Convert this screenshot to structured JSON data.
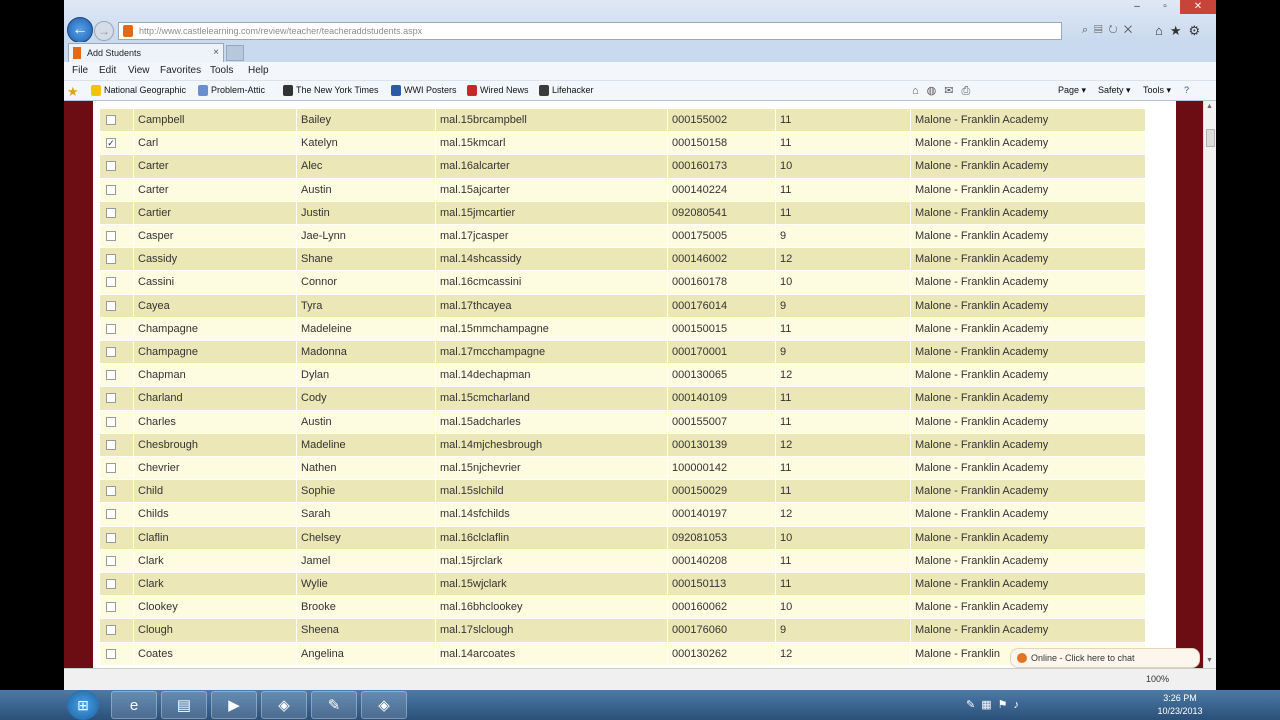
{
  "browser": {
    "url": "http://www.castlelearning.com/review/teacher/teacheraddstudents.aspx",
    "tab_title": "Add Students",
    "tab_close": "×",
    "window_controls": [
      "–",
      "▫",
      "✕"
    ],
    "menu": [
      "File",
      "Edit",
      "View",
      "Favorites",
      "Tools",
      "Help"
    ],
    "favorites": [
      {
        "label": "National Geographic",
        "color": "#f2c400"
      },
      {
        "label": "Problem-Attic",
        "color": "#6a8fd1"
      },
      {
        "label": "The New York Times",
        "color": "#333333"
      },
      {
        "label": "WWI Posters",
        "color": "#2a5aa8"
      },
      {
        "label": "Wired News",
        "color": "#c62828"
      },
      {
        "label": "Lifehacker",
        "color": "#3b3b3b"
      }
    ],
    "commands": [
      "Page ▾",
      "Safety ▾",
      "Tools ▾"
    ],
    "zoom": "100%",
    "chat": "Online - Click here to chat"
  },
  "colors": {
    "frame": "#6b0d12",
    "row_a": "#fdfbe0",
    "row_b": "#ece7b6"
  },
  "rows": [
    {
      "checked": false,
      "last": "Campbell",
      "first": "Bailey",
      "user": "mal.15brcampbell",
      "id": "000155002",
      "grade": "11",
      "school": "Malone - Franklin Academy"
    },
    {
      "checked": true,
      "last": "Carl",
      "first": "Katelyn",
      "user": "mal.15kmcarl",
      "id": "000150158",
      "grade": "11",
      "school": "Malone - Franklin Academy"
    },
    {
      "checked": false,
      "last": "Carter",
      "first": "Alec",
      "user": "mal.16alcarter",
      "id": "000160173",
      "grade": "10",
      "school": "Malone - Franklin Academy"
    },
    {
      "checked": false,
      "last": "Carter",
      "first": "Austin",
      "user": "mal.15ajcarter",
      "id": "000140224",
      "grade": "11",
      "school": "Malone - Franklin Academy"
    },
    {
      "checked": false,
      "last": "Cartier",
      "first": "Justin",
      "user": "mal.15jmcartier",
      "id": "092080541",
      "grade": "11",
      "school": "Malone - Franklin Academy"
    },
    {
      "checked": false,
      "last": "Casper",
      "first": "Jae-Lynn",
      "user": "mal.17jcasper",
      "id": "000175005",
      "grade": "9",
      "school": "Malone - Franklin Academy"
    },
    {
      "checked": false,
      "last": "Cassidy",
      "first": "Shane",
      "user": "mal.14shcassidy",
      "id": "000146002",
      "grade": "12",
      "school": "Malone - Franklin Academy"
    },
    {
      "checked": false,
      "last": "Cassini",
      "first": "Connor",
      "user": "mal.16cmcassini",
      "id": "000160178",
      "grade": "10",
      "school": "Malone - Franklin Academy"
    },
    {
      "checked": false,
      "last": "Cayea",
      "first": "Tyra",
      "user": "mal.17thcayea",
      "id": "000176014",
      "grade": "9",
      "school": "Malone - Franklin Academy"
    },
    {
      "checked": false,
      "last": "Champagne",
      "first": "Madeleine",
      "user": "mal.15mmchampagne",
      "id": "000150015",
      "grade": "11",
      "school": "Malone - Franklin Academy"
    },
    {
      "checked": false,
      "last": "Champagne",
      "first": "Madonna",
      "user": "mal.17mcchampagne",
      "id": "000170001",
      "grade": "9",
      "school": "Malone - Franklin Academy"
    },
    {
      "checked": false,
      "last": "Chapman",
      "first": "Dylan",
      "user": "mal.14dechapman",
      "id": "000130065",
      "grade": "12",
      "school": "Malone - Franklin Academy"
    },
    {
      "checked": false,
      "last": "Charland",
      "first": "Cody",
      "user": "mal.15cmcharland",
      "id": "000140109",
      "grade": "11",
      "school": "Malone - Franklin Academy"
    },
    {
      "checked": false,
      "last": "Charles",
      "first": "Austin",
      "user": "mal.15adcharles",
      "id": "000155007",
      "grade": "11",
      "school": "Malone - Franklin Academy"
    },
    {
      "checked": false,
      "last": "Chesbrough",
      "first": "Madeline",
      "user": "mal.14mjchesbrough",
      "id": "000130139",
      "grade": "12",
      "school": "Malone - Franklin Academy"
    },
    {
      "checked": false,
      "last": "Chevrier",
      "first": "Nathen",
      "user": "mal.15njchevrier",
      "id": "100000142",
      "grade": "11",
      "school": "Malone - Franklin Academy"
    },
    {
      "checked": false,
      "last": "Child",
      "first": "Sophie",
      "user": "mal.15slchild",
      "id": "000150029",
      "grade": "11",
      "school": "Malone - Franklin Academy"
    },
    {
      "checked": false,
      "last": "Childs",
      "first": "Sarah",
      "user": "mal.14sfchilds",
      "id": "000140197",
      "grade": "12",
      "school": "Malone - Franklin Academy"
    },
    {
      "checked": false,
      "last": "Claflin",
      "first": "Chelsey",
      "user": "mal.16clclaflin",
      "id": "092081053",
      "grade": "10",
      "school": "Malone - Franklin Academy"
    },
    {
      "checked": false,
      "last": "Clark",
      "first": "Jamel",
      "user": "mal.15jrclark",
      "id": "000140208",
      "grade": "11",
      "school": "Malone - Franklin Academy"
    },
    {
      "checked": false,
      "last": "Clark",
      "first": "Wylie",
      "user": "mal.15wjclark",
      "id": "000150113",
      "grade": "11",
      "school": "Malone - Franklin Academy"
    },
    {
      "checked": false,
      "last": "Clookey",
      "first": "Brooke",
      "user": "mal.16bhclookey",
      "id": "000160062",
      "grade": "10",
      "school": "Malone - Franklin Academy"
    },
    {
      "checked": false,
      "last": "Clough",
      "first": "Sheena",
      "user": "mal.17slclough",
      "id": "000176060",
      "grade": "9",
      "school": "Malone - Franklin Academy"
    },
    {
      "checked": false,
      "last": "Coates",
      "first": "Angelina",
      "user": "mal.14arcoates",
      "id": "000130262",
      "grade": "12",
      "school": "Malone - Franklin"
    }
  ],
  "taskbar": {
    "start": "⊞",
    "apps": [
      "e",
      "▤",
      "▶",
      "◈",
      "✎",
      "◈"
    ],
    "time": "3:26 PM",
    "date": "10/23/2013"
  }
}
